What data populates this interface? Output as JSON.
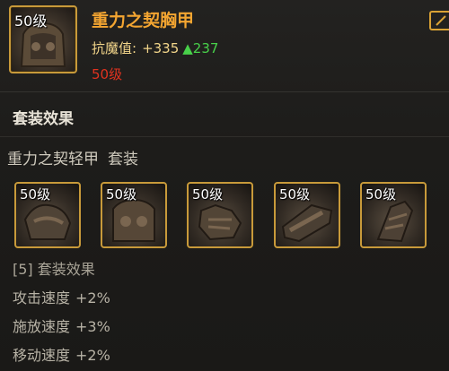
{
  "item": {
    "level_tag": "50级",
    "name": "重力之契胸甲",
    "stat_label": "抗魔值:",
    "stat_base": "+335",
    "stat_bonus": "▲237",
    "required_level": "50级"
  },
  "set_section": {
    "title": "套装效果",
    "set_name": "重力之契轻甲",
    "set_tag": "套装",
    "pieces": [
      {
        "level_tag": "50级",
        "icon": "shoulder-armor-icon"
      },
      {
        "level_tag": "50级",
        "icon": "chest-armor-icon"
      },
      {
        "level_tag": "50级",
        "icon": "gloves-icon"
      },
      {
        "level_tag": "50级",
        "icon": "belt-icon"
      },
      {
        "level_tag": "50级",
        "icon": "boots-icon"
      }
    ],
    "bonus_title": "[5] 套装效果",
    "bonuses": [
      {
        "label": "攻击速度",
        "value": "+2%"
      },
      {
        "label": "施放速度",
        "value": "+3%"
      },
      {
        "label": "移动速度",
        "value": "+2%"
      }
    ]
  },
  "colors": {
    "item_name": "#f3a531",
    "bonus_green": "#48d14a",
    "required_red": "#e0321f",
    "frame_gold": "#c89a3a"
  }
}
